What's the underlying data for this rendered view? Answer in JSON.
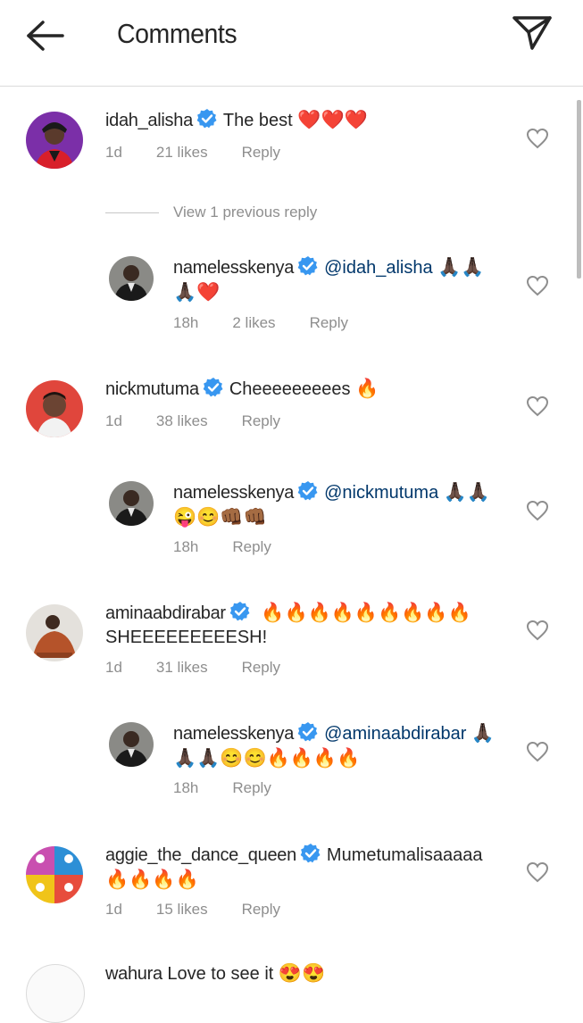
{
  "header": {
    "title": "Comments",
    "back_icon": "arrow-left-icon",
    "send_icon": "paper-plane-icon"
  },
  "view_previous_reply": "View 1 previous reply",
  "comments": [
    {
      "username": "idah_alisha",
      "text": "The best",
      "emojis": "❤️❤️❤️",
      "time": "1d",
      "likes": "21 likes",
      "reply": "Reply"
    },
    {
      "username": "namelesskenya",
      "mention": "@idah_alisha",
      "emojis_line1": "🙏🏿🙏🏿",
      "emojis_line2": "🙏🏿❤️",
      "time": "18h",
      "likes": "2 likes",
      "reply": "Reply"
    },
    {
      "username": "nickmutuma",
      "text": "Cheeeeeeeees",
      "emojis": "🔥",
      "time": "1d",
      "likes": "38 likes",
      "reply": "Reply"
    },
    {
      "username": "namelesskenya",
      "mention": "@nickmutuma",
      "emojis_line1": "🙏🏿🙏🏿",
      "emojis_line2": "😜😊👊🏾👊🏾",
      "time": "18h",
      "reply": "Reply"
    },
    {
      "username": "aminaabdirabar",
      "emojis": "🔥🔥🔥🔥🔥🔥🔥🔥🔥",
      "text_line2": "SHEEEEEEEEESH!",
      "time": "1d",
      "likes": "31 likes",
      "reply": "Reply"
    },
    {
      "username": "namelesskenya",
      "mention": "@aminaabdirabar",
      "emojis_line1": "🙏🏿",
      "emojis_line2": "🙏🏿🙏🏿😊😊🔥🔥🔥🔥",
      "time": "18h",
      "reply": "Reply"
    },
    {
      "username": "aggie_the_dance_queen",
      "text": "Mumetumalisaaaaa",
      "emojis_line2": "🔥🔥🔥🔥",
      "time": "1d",
      "likes": "15 likes",
      "reply": "Reply"
    },
    {
      "username": "wahura",
      "text": "Love to see it",
      "emojis": "😍😍"
    }
  ],
  "colors": {
    "verified": "#3897f0",
    "mention": "#00376b",
    "meta": "#8e8e8e",
    "divider": "#dbdbdb"
  }
}
